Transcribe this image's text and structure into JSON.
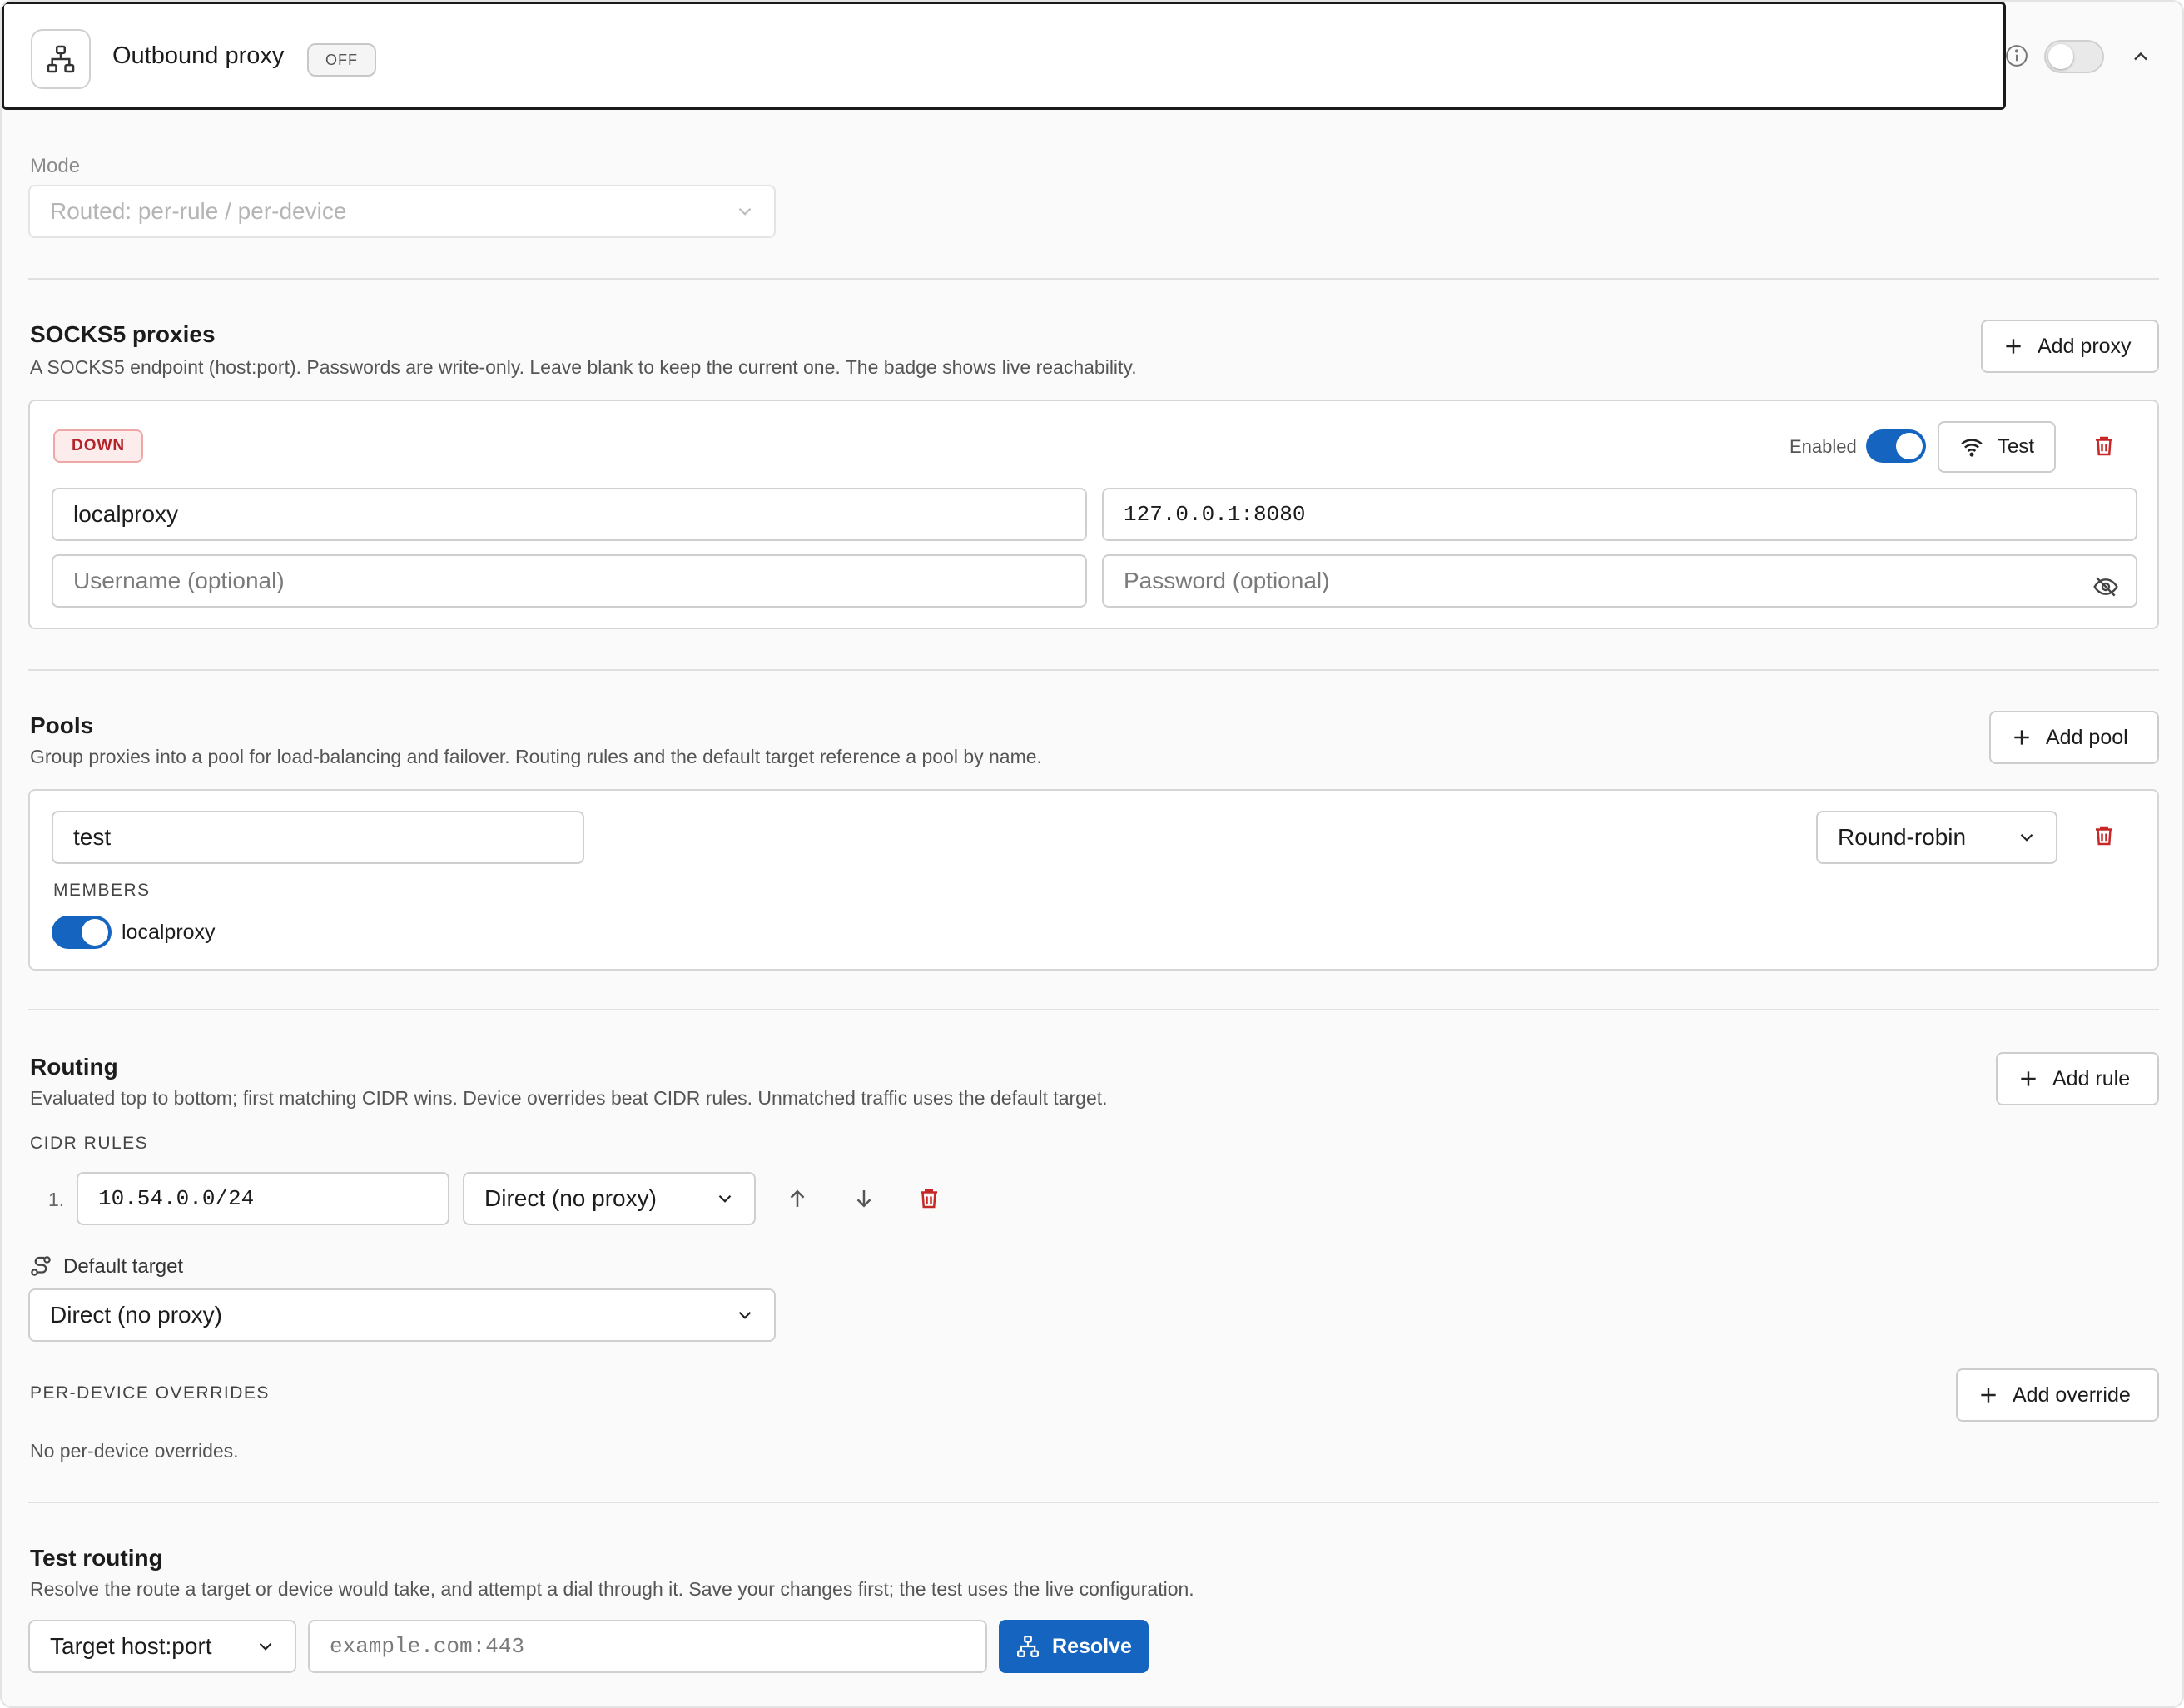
{
  "header": {
    "title": "Outbound proxy",
    "status": "OFF",
    "toggle_enabled": false
  },
  "mode": {
    "label": "Mode",
    "value": "Routed: per-rule / per-device"
  },
  "socks": {
    "title": "SOCKS5 proxies",
    "description": "A SOCKS5 endpoint (host:port). Passwords are write-only. Leave blank to keep the current one. The badge shows live reachability.",
    "add_label": "Add proxy",
    "proxy": {
      "status": "DOWN",
      "enabled_label": "Enabled",
      "enabled": true,
      "test_label": "Test",
      "name": "localproxy",
      "endpoint": "127.0.0.1:8080",
      "username_placeholder": "Username (optional)",
      "password_placeholder": "Password (optional)"
    }
  },
  "pools": {
    "title": "Pools",
    "description": "Group proxies into a pool for load-balancing and failover. Routing rules and the default target reference a pool by name.",
    "add_label": "Add pool",
    "pool": {
      "name": "test",
      "strategy": "Round-robin",
      "members_label": "MEMBERS",
      "member": "localproxy",
      "member_enabled": true
    }
  },
  "routing": {
    "title": "Routing",
    "description": "Evaluated top to bottom; first matching CIDR wins. Device overrides beat CIDR rules. Unmatched traffic uses the default target.",
    "add_label": "Add rule",
    "cidr_label": "CIDR RULES",
    "rule": {
      "index": "1.",
      "cidr": "10.54.0.0/24",
      "target": "Direct (no proxy)"
    },
    "default_target_label": "Default target",
    "default_target": "Direct (no proxy)",
    "overrides_label": "PER-DEVICE OVERRIDES",
    "add_override_label": "Add override",
    "no_overrides": "No per-device overrides."
  },
  "test_routing": {
    "title": "Test routing",
    "description": "Resolve the route a target or device would take, and attempt a dial through it. Save your changes first; the test uses the live configuration.",
    "kind": "Target host:port",
    "placeholder": "example.com:443",
    "resolve_label": "Resolve"
  },
  "colors": {
    "accent": "#1565c0",
    "danger": "#c62828",
    "down_badge_bg": "#fdecec"
  }
}
